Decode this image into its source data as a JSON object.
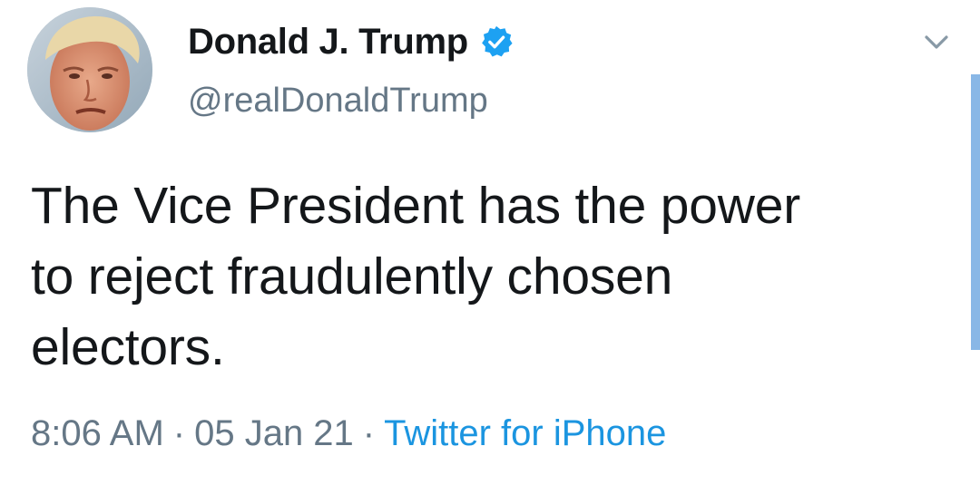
{
  "author": {
    "display_name": "Donald J. Trump",
    "handle": "@realDonaldTrump",
    "verified": true,
    "verified_icon": "verified-badge-icon",
    "avatar_icon": "profile-photo"
  },
  "menu": {
    "icon": "chevron-down-icon"
  },
  "tweet": {
    "text_lines": [
      "The Vice President has the power",
      "to reject fraudulently chosen",
      "electors."
    ],
    "time": "8:06 AM",
    "date": "05 Jan 21",
    "separator": "·",
    "source": "Twitter for iPhone"
  },
  "colors": {
    "text": "#14171a",
    "secondary": "#657786",
    "link": "#1b95e0",
    "verified": "#1da1f2",
    "scrollbar": "#89b7e6"
  }
}
